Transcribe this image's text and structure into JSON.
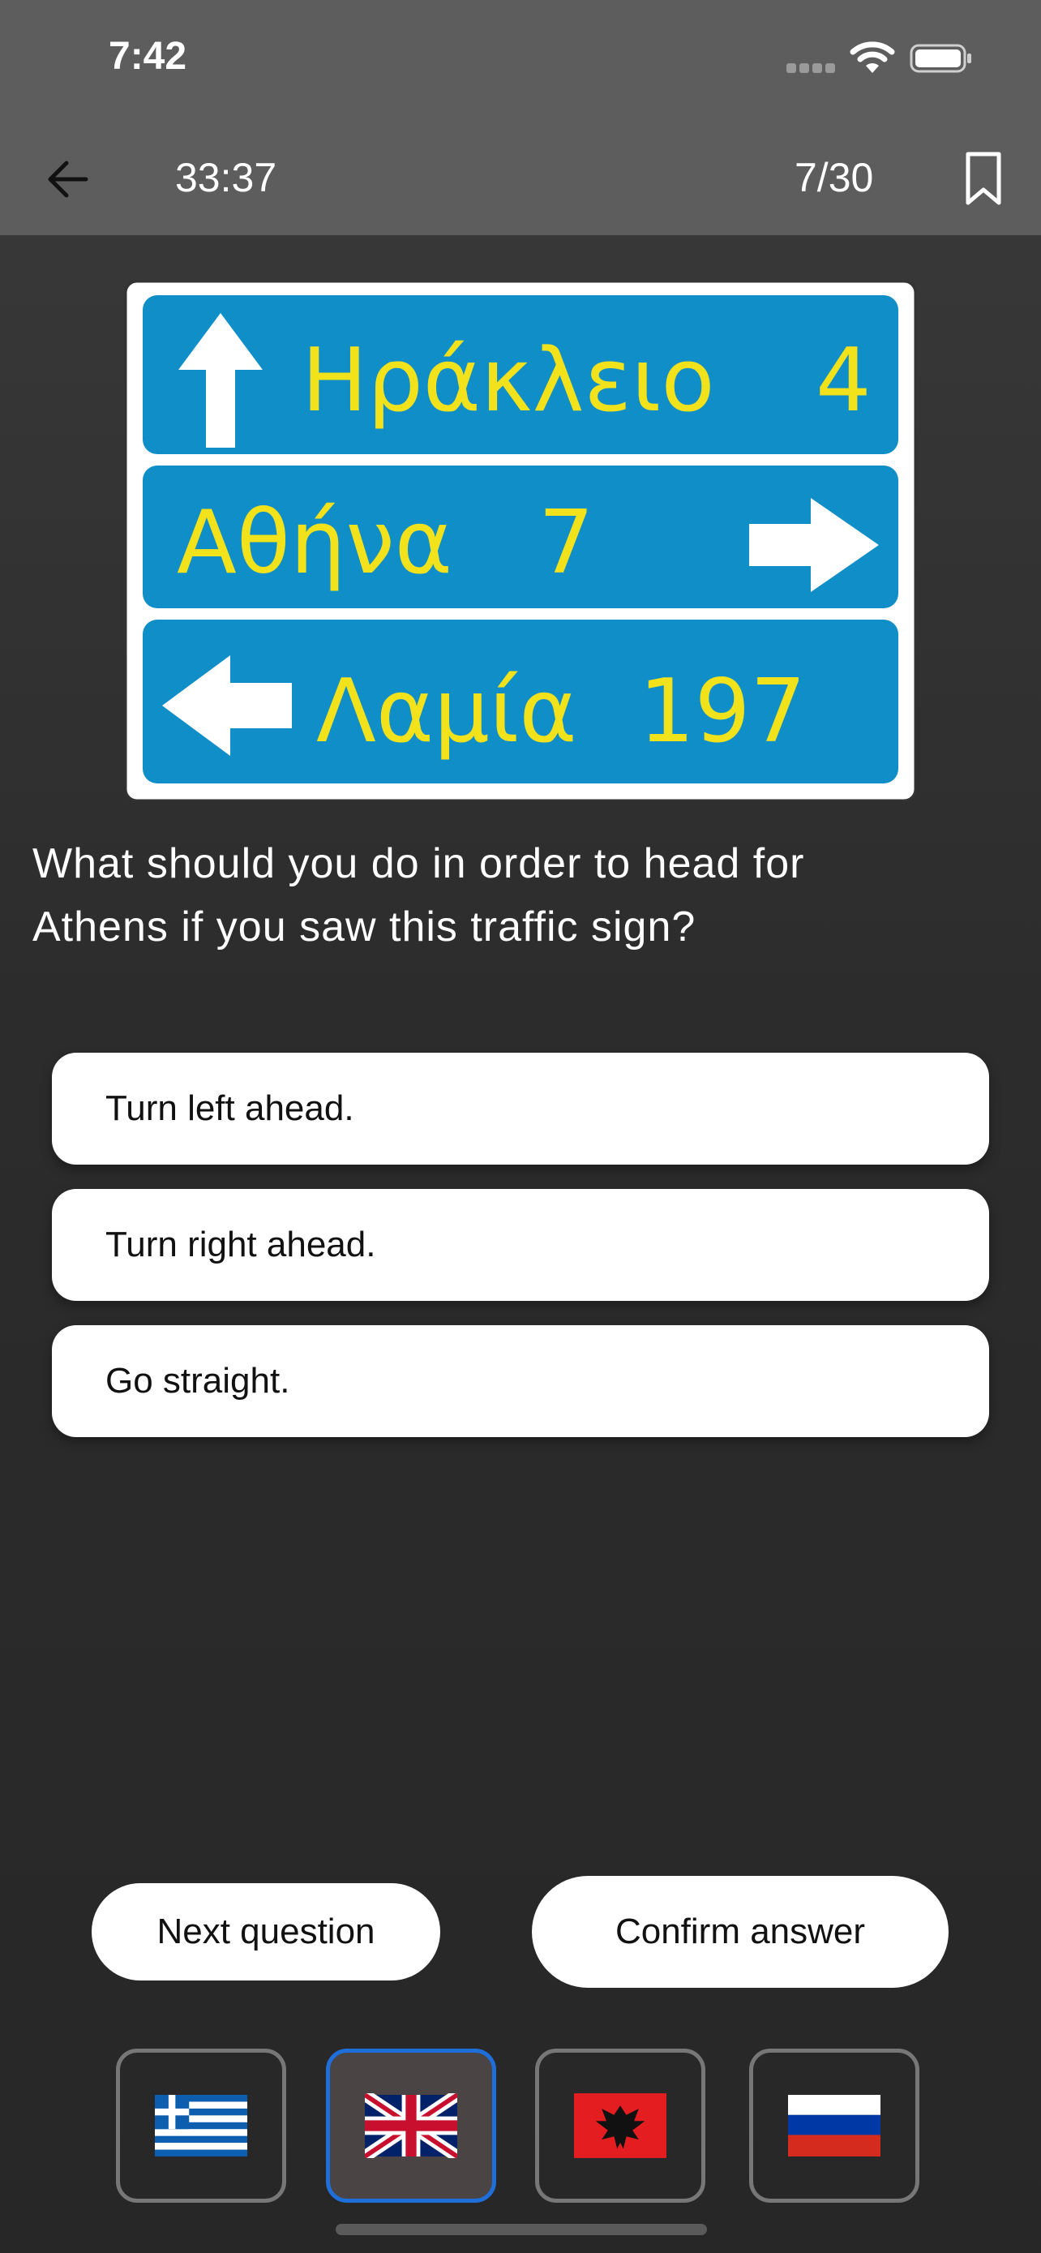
{
  "status_bar": {
    "time": "7:42"
  },
  "app_bar": {
    "timer": "33:37",
    "progress": "7/30",
    "back_icon": "arrow-left-icon",
    "bookmark_icon": "bookmark-icon"
  },
  "sign": {
    "rows": [
      {
        "destination": "Ηράκλειο",
        "distance": "4",
        "arrow": "up"
      },
      {
        "destination": "Αθήνα",
        "distance": "7",
        "arrow": "right"
      },
      {
        "destination": "Λαμία",
        "distance": "197",
        "arrow": "left"
      }
    ],
    "colors": {
      "panel": "#0f8ec8",
      "text": "#f2e21c",
      "frame": "#ffffff"
    }
  },
  "question": {
    "line1": "What should you do in order to head for",
    "line2": "Athens if you saw this traffic sign?"
  },
  "options": [
    "Turn left ahead.",
    "Turn right ahead.",
    "Go straight."
  ],
  "actions": {
    "next": "Next question",
    "confirm": "Confirm answer"
  },
  "languages": [
    {
      "name": "greek-flag-icon",
      "selected": false
    },
    {
      "name": "uk-flag-icon",
      "selected": true
    },
    {
      "name": "albania-flag-icon",
      "selected": false
    },
    {
      "name": "russia-flag-icon",
      "selected": false
    }
  ],
  "colors": {
    "selected_border": "#1e6fd9",
    "bar_background": "#5d5d5d"
  }
}
